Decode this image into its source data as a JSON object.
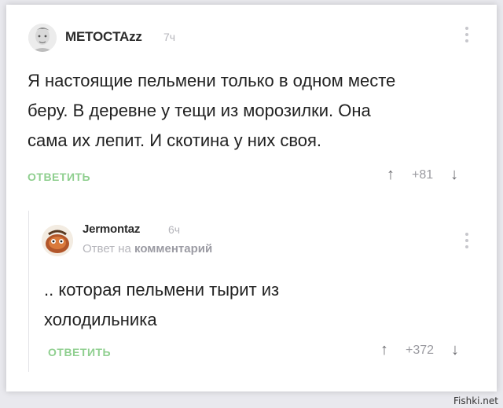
{
  "comments": [
    {
      "author": "METOCTAzz",
      "time": "7ч",
      "text_lines": [
        "Я настоящие пельмени только в одном месте",
        "беру. В деревне у тещи из морозилки. Она",
        "сама их лепит. И скотина у них своя."
      ],
      "reply_label": "ОТВЕТИТЬ",
      "score": "+81",
      "up_icon": "arrow-up-icon",
      "down_icon": "arrow-down-icon"
    },
    {
      "author": "Jermontaz",
      "time": "6ч",
      "reply_to_prefix": "Ответ на",
      "reply_to_link": "комментарий",
      "text_lines": [
        ".. которая пельмени  тырит из",
        "холодильника"
      ],
      "reply_label": "ОТВЕТИТЬ",
      "score": "+372"
    }
  ],
  "watermark": "Fishki.net",
  "colors": {
    "reply": "#8fcf8f",
    "muted": "#b5b5bb",
    "text": "#222222"
  }
}
